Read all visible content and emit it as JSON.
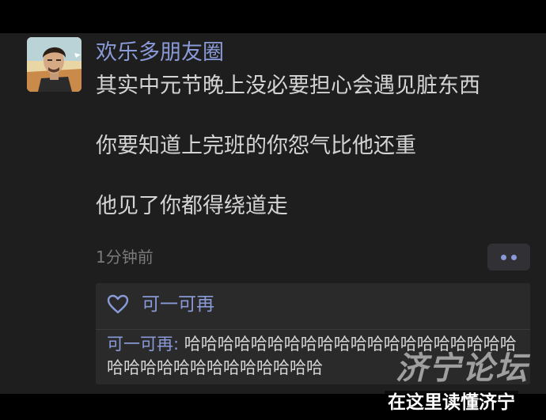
{
  "post": {
    "username": "欢乐多朋友圈",
    "lines": [
      "其实中元节晚上没必要担心会遇见脏东西",
      "你要知道上完班的你怨气比他还重",
      "他见了你都得绕道走"
    ],
    "time": "1分钟前"
  },
  "interaction": {
    "likes": "可一可再",
    "comments": [
      {
        "author": "可一可再:",
        "text": " 哈哈哈哈哈哈哈哈哈哈哈哈哈哈哈哈哈哈哈哈哈哈哈哈哈哈哈哈哈哈哈哈哈"
      }
    ]
  },
  "watermark": {
    "brand": "济宁论坛",
    "slogan": "在这里读懂济宁"
  },
  "icons": {
    "avatar": "avatar-illustration",
    "like": "heart-outline-icon",
    "more": "more-dots-icon"
  },
  "colors": {
    "background": "#000000",
    "card": "#1e1e1e",
    "panel": "#2a2a2a",
    "name_link": "#8a9ad8",
    "text": "#d4d4d4",
    "meta": "#7a7a7a"
  }
}
